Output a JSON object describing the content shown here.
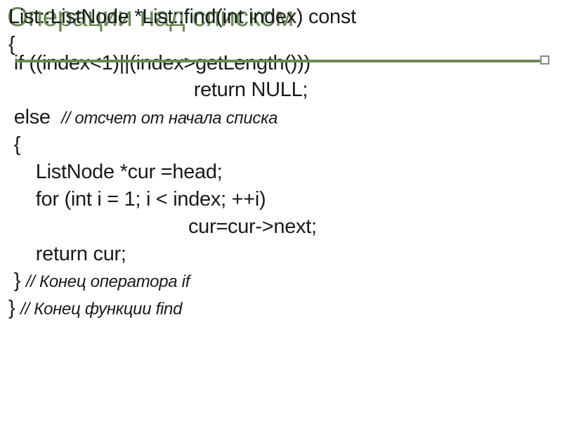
{
  "slide": {
    "title": "Операции над списком",
    "lines": {
      "l1": "List::ListNode *List::find(int index) const",
      "l2": "{",
      "l3": " if ((index<1)||(index>getLength()))",
      "l4": "                                  return NULL;",
      "l5a": " else  ",
      "l5b": "// отсчет от начала списка",
      "l6": " {",
      "l7": "     ListNode *cur =head;",
      "l8": "     for (int i = 1; i < index; ++i)",
      "l9": "                                 cur=cur->next;",
      "l10": "     return cur;",
      "l11a": " } ",
      "l11b": "// Конец оператора if",
      "l12a": "} ",
      "l12b": "// Конец функции find"
    }
  }
}
